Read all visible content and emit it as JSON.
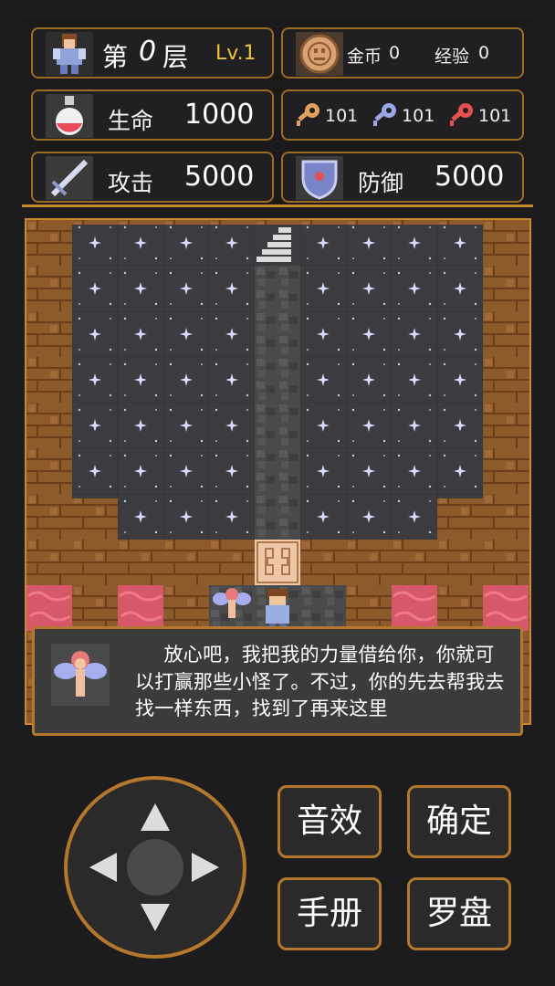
{
  "status": {
    "floor_prefix": "第",
    "floor_number": "0",
    "floor_suffix": "层",
    "level": "Lv.1",
    "gold_label": "金币",
    "gold_value": "0",
    "exp_label": "经验",
    "exp_value": "0",
    "hp_label": "生命",
    "hp_value": "1000",
    "atk_label": "攻击",
    "atk_value": "5000",
    "def_label": "防御",
    "def_value": "5000",
    "yellow_keys": "101",
    "blue_keys": "101",
    "red_keys": "101"
  },
  "dialog": {
    "speaker_icon": "fairy-portrait",
    "text": "放心吧，我把我的力量借给你，你就可以打赢那些小怪了。不过，你的先去帮我去找一样东西，找到了再来这里"
  },
  "controls": {
    "sound_label": "音效",
    "confirm_label": "确定",
    "manual_label": "手册",
    "compass_label": "罗盘"
  },
  "colors": {
    "accent": "#b4772b",
    "level": "#f0c23a",
    "background": "#1c1c1e"
  }
}
